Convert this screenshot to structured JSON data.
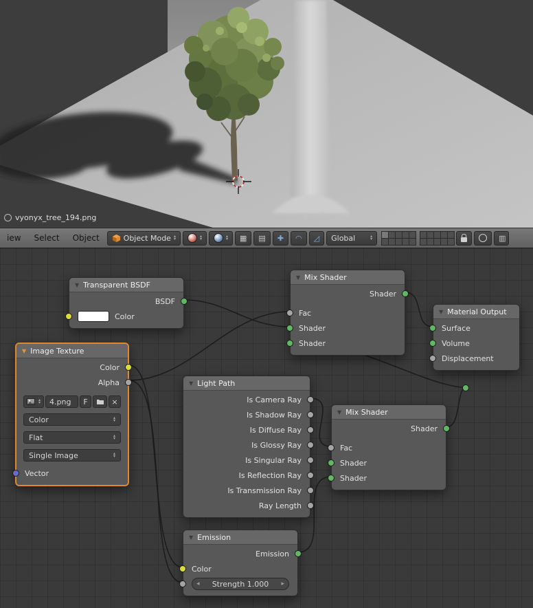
{
  "viewport": {
    "filename_label": "vyonyx_tree_194.png"
  },
  "header": {
    "menu_view": "iew",
    "menu_select": "Select",
    "menu_object": "Object",
    "mode_label": "Object Mode",
    "orientation_label": "Global"
  },
  "icons": {
    "collapse_triangle": "▼",
    "dropdown_up": "▴",
    "dropdown_down": "▾",
    "slider_left": "◂",
    "slider_right": "▸",
    "close": "×"
  },
  "nodes": {
    "transparent_bsdf": {
      "title": "Transparent BSDF",
      "output_bsdf": "BSDF",
      "input_color": "Color"
    },
    "mix_shader_top": {
      "title": "Mix Shader",
      "output_shader": "Shader",
      "input_fac": "Fac",
      "input_shader1": "Shader",
      "input_shader2": "Shader"
    },
    "material_output": {
      "title": "Material Output",
      "input_surface": "Surface",
      "input_volume": "Volume",
      "input_displacement": "Displacement"
    },
    "image_texture": {
      "title": "Image Texture",
      "output_color": "Color",
      "output_alpha": "Alpha",
      "filename": "4.png",
      "fake_user_label": "F",
      "color_space": "Color",
      "projection": "Flat",
      "source": "Single Image",
      "input_vector": "Vector"
    },
    "light_path": {
      "title": "Light Path",
      "outputs": [
        "Is Camera Ray",
        "Is Shadow Ray",
        "Is Diffuse Ray",
        "Is Glossy Ray",
        "Is Singular Ray",
        "Is Reflection Ray",
        "Is Transmission Ray",
        "Ray Length"
      ]
    },
    "mix_shader_bottom": {
      "title": "Mix Shader",
      "output_shader": "Shader",
      "input_fac": "Fac",
      "input_shader1": "Shader",
      "input_shader2": "Shader"
    },
    "emission": {
      "title": "Emission",
      "output_emission": "Emission",
      "input_color": "Color",
      "strength_label": "Strength 1.000"
    }
  },
  "colors": {
    "socket_shader": "#63b763",
    "socket_color": "#dcdc3c",
    "socket_value": "#a5a5a5",
    "socket_vector": "#6a6ac8",
    "selection_outline": "#e0882b"
  }
}
